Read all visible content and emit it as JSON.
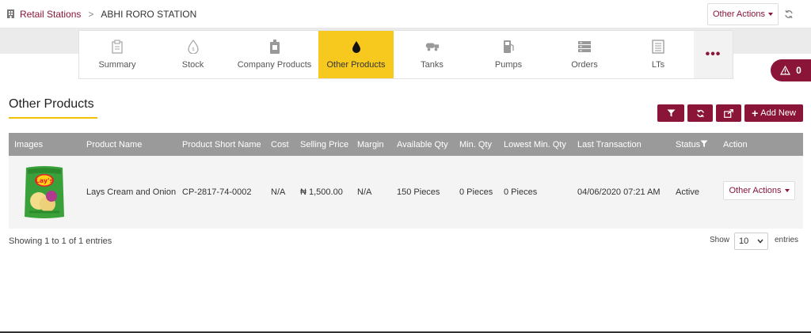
{
  "breadcrumb": {
    "root": "Retail Stations",
    "separator": ">",
    "current": "ABHI RORO STATION"
  },
  "header": {
    "other_actions": "Other Actions"
  },
  "tabs": [
    {
      "label": "Summary",
      "icon": "clipboard-icon"
    },
    {
      "label": "Stock",
      "icon": "drop-outline-icon"
    },
    {
      "label": "Company Products",
      "icon": "jerrycan-icon"
    },
    {
      "label": "Other Products",
      "icon": "oil-drop-icon",
      "active": true
    },
    {
      "label": "Tanks",
      "icon": "tanker-icon"
    },
    {
      "label": "Pumps",
      "icon": "fuel-pump-icon"
    },
    {
      "label": "Orders",
      "icon": "server-icon"
    },
    {
      "label": "LTs",
      "icon": "list-document-icon"
    }
  ],
  "alert": {
    "count": "0"
  },
  "page": {
    "title": "Other Products"
  },
  "toolbar": {
    "add_new": "Add New"
  },
  "table": {
    "columns": [
      "Images",
      "Product Name",
      "Product Short Name",
      "Cost",
      "Selling Price",
      "Margin",
      "Available Qty",
      "Min. Qty",
      "Lowest Min. Qty",
      "Last Transaction",
      "Status",
      "Action"
    ],
    "rows": [
      {
        "image": "lays-chips-bag",
        "product_name": "Lays Cream and Onion",
        "short_name": "CP-2817-74-0002",
        "cost": "N/A",
        "selling_price": "₦ 1,500.00",
        "margin": "N/A",
        "available_qty": "150 Pieces",
        "min_qty": "0 Pieces",
        "lowest_min_qty": "0 Pieces",
        "last_transaction": "04/06/2020 07:21 AM",
        "status": "Active",
        "action": "Other Actions",
        "image_text": "Lay's"
      }
    ]
  },
  "footer": {
    "info": "Showing 1 to 1 of 1 entries",
    "show": "Show",
    "page_size": "10",
    "entries": "entries"
  },
  "colors": {
    "brand": "#8b1538",
    "active_tab": "#f7c81e",
    "table_header": "#9a9a9a"
  }
}
